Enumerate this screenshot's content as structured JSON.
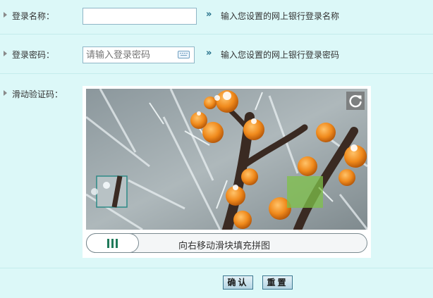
{
  "form": {
    "username": {
      "label": "登录名称：",
      "value": "",
      "placeholder": "",
      "hint": "输入您设置的网上银行登录名称"
    },
    "password": {
      "label": "登录密码：",
      "value": "",
      "placeholder": "请输入登录密码",
      "hint": "输入您设置的网上银行登录密码"
    },
    "captcha": {
      "label": "滑动验证码：",
      "slider_text": "向右移动滑块填充拼图",
      "refresh_icon": "refresh-icon",
      "knob_icon": "grip-bars-icon"
    }
  },
  "actions": {
    "confirm_label": "确认",
    "reset_label": "重置"
  },
  "colors": {
    "page_background": "#dcf8f8",
    "hint_arrow": "#1f6b86",
    "knob_bars": "#1f7a5a",
    "puzzle_target": "#7fc24a"
  }
}
